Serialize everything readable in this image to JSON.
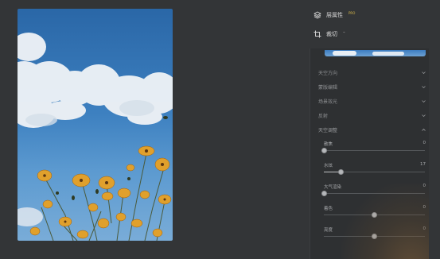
{
  "panel": {
    "layer_props": {
      "label": "层属性",
      "badge": "PRO",
      "icon": "layers-icon"
    },
    "crop": {
      "label": "裁切",
      "badge": "⌁",
      "icon": "crop-icon"
    },
    "sections": [
      {
        "label": "天空方向",
        "expanded": false
      },
      {
        "label": "蒙版编辑",
        "expanded": false
      },
      {
        "label": "场景效光",
        "expanded": false
      },
      {
        "label": "反射",
        "expanded": false
      },
      {
        "label": "天空调整",
        "expanded": true
      }
    ],
    "sliders": [
      {
        "label": "散焦",
        "value": "0",
        "level": 0.0,
        "bipolar": false
      },
      {
        "label": "水炫",
        "value": "17",
        "level": 0.17,
        "bipolar": false
      },
      {
        "label": "大气渲染",
        "value": "0",
        "level": 0.0,
        "bipolar": false
      },
      {
        "label": "着色",
        "value": "0",
        "level": 0.5,
        "bipolar": true
      },
      {
        "label": "亮度",
        "value": "0",
        "level": 0.5,
        "bipolar": true
      }
    ]
  },
  "colors": {
    "background": "#333537",
    "panel_bg": "#2e3032",
    "pro_badge": "#d7b84a",
    "sky": "#2a67a7"
  }
}
